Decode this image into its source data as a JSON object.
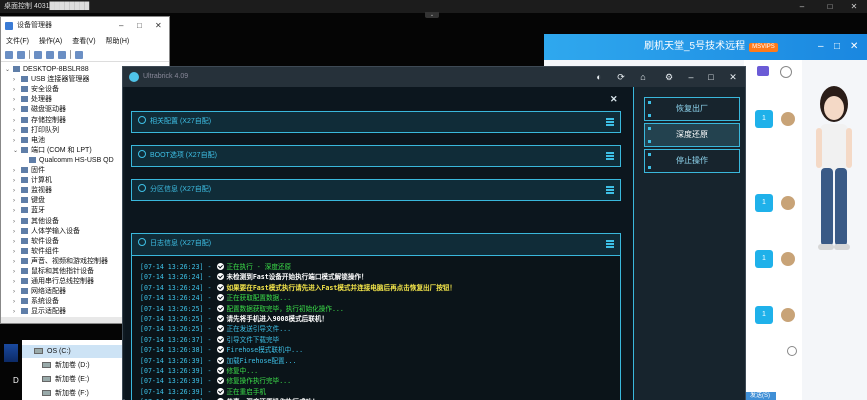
{
  "remote_bar": {
    "title": "桌面控制 4031████████"
  },
  "device_manager": {
    "title": "设备管理器",
    "menu": [
      "文件(F)",
      "操作(A)",
      "查看(V)",
      "帮助(H)"
    ],
    "tree": [
      {
        "label": "DESKTOP-8BSLR88",
        "level": 0,
        "exp": "⌄"
      },
      {
        "label": "USB 连接器管理器",
        "level": 1,
        "exp": "›"
      },
      {
        "label": "安全设备",
        "level": 1,
        "exp": "›"
      },
      {
        "label": "处理器",
        "level": 1,
        "exp": "›"
      },
      {
        "label": "磁盘驱动器",
        "level": 1,
        "exp": "›"
      },
      {
        "label": "存储控制器",
        "level": 1,
        "exp": "›"
      },
      {
        "label": "打印队列",
        "level": 1,
        "exp": "›"
      },
      {
        "label": "电池",
        "level": 1,
        "exp": "›"
      },
      {
        "label": "端口 (COM 和 LPT)",
        "level": 1,
        "exp": "⌄"
      },
      {
        "label": "Qualcomm HS-USB QD",
        "level": 2,
        "exp": ""
      },
      {
        "label": "固件",
        "level": 1,
        "exp": "›"
      },
      {
        "label": "计算机",
        "level": 1,
        "exp": "›"
      },
      {
        "label": "监视器",
        "level": 1,
        "exp": "›"
      },
      {
        "label": "键盘",
        "level": 1,
        "exp": "›"
      },
      {
        "label": "蓝牙",
        "level": 1,
        "exp": "›"
      },
      {
        "label": "其他设备",
        "level": 1,
        "exp": "›"
      },
      {
        "label": "人体学输入设备",
        "level": 1,
        "exp": "›"
      },
      {
        "label": "软件设备",
        "level": 1,
        "exp": "›"
      },
      {
        "label": "软件组件",
        "level": 1,
        "exp": "›"
      },
      {
        "label": "声音、视频和游戏控制器",
        "level": 1,
        "exp": "›"
      },
      {
        "label": "鼠标和其他指针设备",
        "level": 1,
        "exp": "›"
      },
      {
        "label": "通用串行总线控制器",
        "level": 1,
        "exp": "›"
      },
      {
        "label": "网络适配器",
        "level": 1,
        "exp": "›"
      },
      {
        "label": "系统设备",
        "level": 1,
        "exp": "›"
      },
      {
        "label": "显示适配器",
        "level": 1,
        "exp": "›"
      }
    ]
  },
  "explorer": {
    "drives": [
      "OS (C:)",
      "新加卷 (D:)",
      "新加卷 (E:)",
      "新加卷 (F:)"
    ],
    "desktop_label": "D"
  },
  "chat": {
    "title": "刷机天堂_5号技术远程",
    "badge": "MSVIPS",
    "msg_count": "1",
    "bottom_label": "发送(S)"
  },
  "tool": {
    "app_name": "Ultrabrick 4.09",
    "sections": [
      {
        "label": "相关配置 (X27自配)"
      },
      {
        "label": "BOOT选项 (X27自配)"
      },
      {
        "label": "分区信息 (X27自配)"
      }
    ],
    "log_header": "日志信息 (X27自配)",
    "log": [
      {
        "ts": "[07-14 13:26:23]",
        "text": "正在执行 - 深度还原",
        "color": "green"
      },
      {
        "ts": "[07-14 13:26:24]",
        "text": "未检测到Fast设备开始执行端口模式解锁操作！",
        "color": "white"
      },
      {
        "ts": "[07-14 13:26:24]",
        "text": "如果要在Fast模式执行请先进入Fast模式并连接电脑后再点击恢复出厂按钮！",
        "color": "yellow"
      },
      {
        "ts": "[07-14 13:26:24]",
        "text": "正在获取配置数据...",
        "color": "green"
      },
      {
        "ts": "[07-14 13:26:25]",
        "text": "配置数据获取完毕，执行初始化操作...",
        "color": "green"
      },
      {
        "ts": "[07-14 13:26:25]",
        "text": "请先将手机进入9008模式后联机！",
        "color": "white"
      },
      {
        "ts": "[07-14 13:26:25]",
        "text": "正在发送引导文件...",
        "color": "cyan"
      },
      {
        "ts": "[07-14 13:26:37]",
        "text": "引导文件下载完毕",
        "color": "cyan"
      },
      {
        "ts": "[07-14 13:26:38]",
        "text": "Firehose模式联机中...",
        "color": "cyan"
      },
      {
        "ts": "[07-14 13:26:39]",
        "text": "加载Firehose配置...",
        "color": "cyan"
      },
      {
        "ts": "[07-14 13:26:39]",
        "text": "修复中...",
        "color": "green"
      },
      {
        "ts": "[07-14 13:26:39]",
        "text": "修复操作执行完毕...",
        "color": "green"
      },
      {
        "ts": "[07-14 13:26:39]",
        "text": "正在重启手机",
        "color": "green"
      },
      {
        "ts": "[07-14 13:26:39]",
        "text": "恭喜，深度还原操作执行成功！",
        "color": "white"
      }
    ],
    "side_buttons": [
      "恢复出厂",
      "深度还原",
      "停止操作"
    ]
  },
  "colors": {
    "accent": "#3ec0e6",
    "panel": "#0c161e",
    "chat_head": "#1a87e0"
  }
}
